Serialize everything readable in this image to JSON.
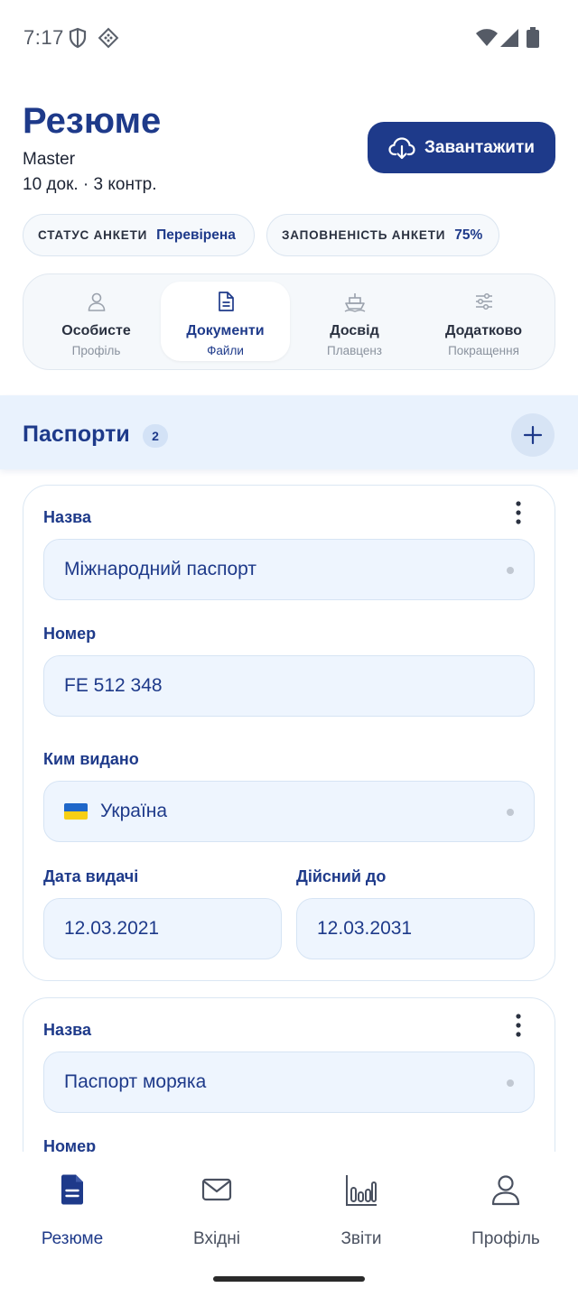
{
  "status_bar": {
    "time": "7:17"
  },
  "header": {
    "title": "Резюме",
    "rank": "Master",
    "summary": "10 док. · 3 контр.",
    "download_label": "Завантажити"
  },
  "pills": [
    {
      "label": "СТАТУС АНКЕТИ",
      "value": "Перевірена"
    },
    {
      "label": "ЗАПОВНЕНІСТЬ АНКЕТИ",
      "value": "75%"
    }
  ],
  "tabs": [
    {
      "label": "Особисте",
      "sub": "Профіль",
      "icon": "person-icon"
    },
    {
      "label": "Документи",
      "sub": "Файли",
      "icon": "document-icon"
    },
    {
      "label": "Досвід",
      "sub": "Плавценз",
      "icon": "ship-icon"
    },
    {
      "label": "Додатково",
      "sub": "Покращення",
      "icon": "sliders-icon"
    }
  ],
  "section": {
    "title": "Паспорти",
    "count": "2"
  },
  "cards": [
    {
      "name_label": "Назва",
      "name_value": "Міжнародний паспорт",
      "number_label": "Номер",
      "number_value": "FE 512 348",
      "issuer_label": "Ким видано",
      "issuer_value": "Україна",
      "issue_date_label": "Дата видачі",
      "issue_date_value": "12.03.2021",
      "valid_until_label": "Дійсний до",
      "valid_until_value": "12.03.2031"
    },
    {
      "name_label": "Назва",
      "name_value": "Паспорт моряка",
      "number_label": "Номер"
    }
  ],
  "bottom_nav": [
    {
      "label": "Резюме",
      "icon": "resume-icon"
    },
    {
      "label": "Вхідні",
      "icon": "mail-icon"
    },
    {
      "label": "Звіти",
      "icon": "chart-icon"
    },
    {
      "label": "Профіль",
      "icon": "profile-icon"
    }
  ],
  "colors": {
    "accent": "#1e3a8a",
    "field_bg": "#eef5fe",
    "section_bg": "#e9f2fd"
  }
}
